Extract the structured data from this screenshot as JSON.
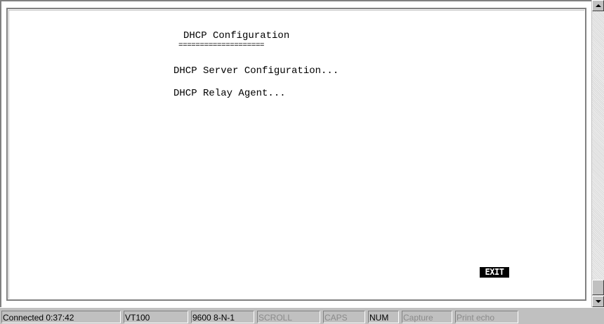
{
  "terminal": {
    "title": "DHCP Configuration",
    "title_underline": "====================",
    "menu_items": [
      {
        "label": "DHCP Server Configuration..."
      },
      {
        "label": "DHCP Relay Agent..."
      }
    ],
    "exit_label": "EXIT"
  },
  "statusbar": {
    "connected": "Connected 0:37:42",
    "emulation": "VT100",
    "port_settings": "9600 8-N-1",
    "scroll": "SCROLL",
    "caps": "CAPS",
    "num": "NUM",
    "capture": "Capture",
    "print_echo": "Print echo"
  },
  "colors": {
    "status_dim_text": "#8a8a8a",
    "background": "#ffffff"
  }
}
